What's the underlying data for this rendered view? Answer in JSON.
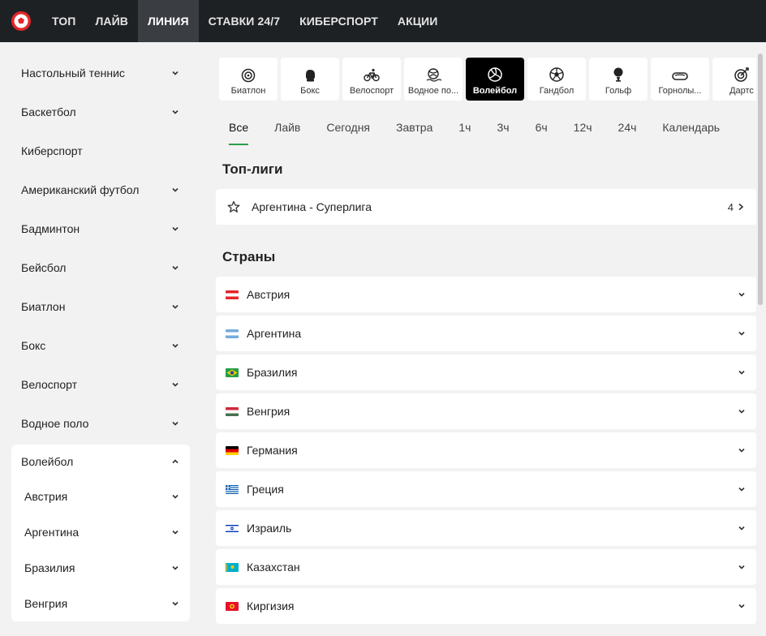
{
  "nav": {
    "items": [
      {
        "label": "ТОП",
        "active": false
      },
      {
        "label": "ЛАЙВ",
        "active": false
      },
      {
        "label": "ЛИНИЯ",
        "active": true
      },
      {
        "label": "СТАВКИ 24/7",
        "active": false
      },
      {
        "label": "КИБЕРСПОРТ",
        "active": false
      },
      {
        "label": "АКЦИИ",
        "active": false
      }
    ]
  },
  "sidebar": {
    "items": [
      {
        "label": "Настольный теннис",
        "expandable": true
      },
      {
        "label": "Баскетбол",
        "expandable": true
      },
      {
        "label": "Киберспорт",
        "expandable": false
      },
      {
        "label": "Американский футбол",
        "expandable": true
      },
      {
        "label": "Бадминтон",
        "expandable": true
      },
      {
        "label": "Бейсбол",
        "expandable": true
      },
      {
        "label": "Биатлон",
        "expandable": true
      },
      {
        "label": "Бокс",
        "expandable": true
      },
      {
        "label": "Велоспорт",
        "expandable": true
      },
      {
        "label": "Водное поло",
        "expandable": true
      }
    ],
    "open": {
      "label": "Волейбол",
      "children": [
        "Австрия",
        "Аргентина",
        "Бразилия",
        "Венгрия"
      ]
    }
  },
  "sports": [
    {
      "label": "Биатлон",
      "icon": "target-icon",
      "active": false
    },
    {
      "label": "Бокс",
      "icon": "boxing-glove-icon",
      "active": false
    },
    {
      "label": "Велоспорт",
      "icon": "bicycle-icon",
      "active": false
    },
    {
      "label": "Водное по...",
      "icon": "water-polo-icon",
      "active": false
    },
    {
      "label": "Волейбол",
      "icon": "volleyball-icon",
      "active": true
    },
    {
      "label": "Гандбол",
      "icon": "handball-icon",
      "active": false
    },
    {
      "label": "Гольф",
      "icon": "golf-icon",
      "active": false
    },
    {
      "label": "Горнолы...",
      "icon": "ski-goggles-icon",
      "active": false
    },
    {
      "label": "Дартс",
      "icon": "darts-icon",
      "active": false
    }
  ],
  "filters": [
    {
      "label": "Все",
      "active": true
    },
    {
      "label": "Лайв",
      "active": false
    },
    {
      "label": "Сегодня",
      "active": false
    },
    {
      "label": "Завтра",
      "active": false
    },
    {
      "label": "1ч",
      "active": false
    },
    {
      "label": "3ч",
      "active": false
    },
    {
      "label": "6ч",
      "active": false
    },
    {
      "label": "12ч",
      "active": false
    },
    {
      "label": "24ч",
      "active": false
    },
    {
      "label": "Календарь",
      "active": false
    }
  ],
  "top_leagues": {
    "title": "Топ-лиги",
    "items": [
      {
        "name": "Аргентина - Суперлига",
        "count": "4"
      }
    ]
  },
  "countries": {
    "title": "Страны",
    "items": [
      {
        "name": "Австрия",
        "flag": "austria"
      },
      {
        "name": "Аргентина",
        "flag": "argentina"
      },
      {
        "name": "Бразилия",
        "flag": "brazil"
      },
      {
        "name": "Венгрия",
        "flag": "hungary"
      },
      {
        "name": "Германия",
        "flag": "germany"
      },
      {
        "name": "Греция",
        "flag": "greece"
      },
      {
        "name": "Израиль",
        "flag": "israel"
      },
      {
        "name": "Казахстан",
        "flag": "kazakhstan"
      },
      {
        "name": "Киргизия",
        "flag": "kyrgyzstan"
      }
    ]
  },
  "colors": {
    "nav_bg": "#1e2124",
    "nav_active_bg": "#3a3d41",
    "accent_green": "#2a9d4a",
    "logo_red": "#e3262b"
  }
}
